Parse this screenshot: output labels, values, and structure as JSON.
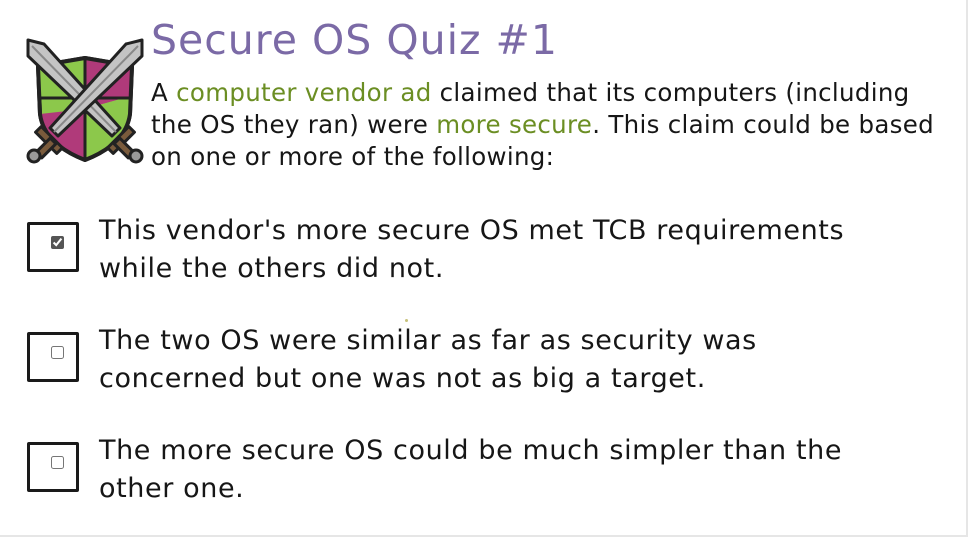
{
  "quiz": {
    "title": "Secure OS Quiz #1",
    "prompt": {
      "part1": "A ",
      "highlight1": "computer vendor ad",
      "part2": " claimed that its computers (including the OS they ran) were ",
      "highlight2": "more secure",
      "part3": ". This claim could be based on one or more of the following:"
    },
    "options": [
      {
        "text": "This vendor's more secure OS met TCB requirements while the others did not.",
        "checked": true
      },
      {
        "text": "The two OS were similar as far as security was concerned but one was not as big a target.",
        "checked": false
      },
      {
        "text": "The more secure OS could be much simpler than the other one.",
        "checked": false
      }
    ]
  },
  "colors": {
    "title": "#7b6aa6",
    "highlight": "#6b8e23",
    "text": "#161616",
    "shield_magenta": "#b03a7a",
    "shield_green": "#8cc84b",
    "sword_gray": "#b9b9b9"
  },
  "icons": {
    "crest": "shield-crossed-swords-icon"
  }
}
